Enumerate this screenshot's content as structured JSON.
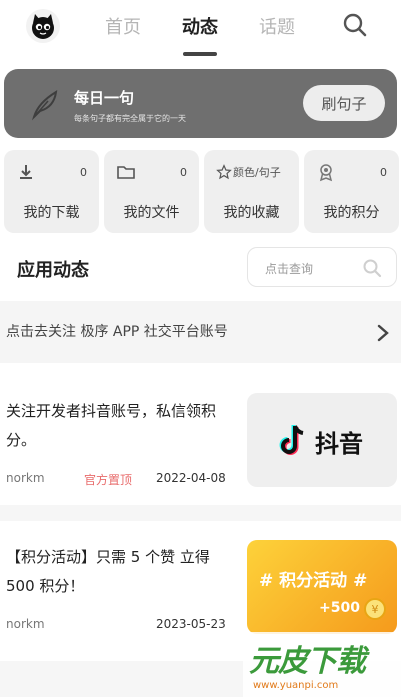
{
  "nav": {
    "tabs": [
      {
        "label": "首页",
        "active": false
      },
      {
        "label": "动态",
        "active": true
      },
      {
        "label": "话题",
        "active": false
      }
    ],
    "search_icon": "search-icon",
    "avatar_icon": "cat-mascot-avatar"
  },
  "banner": {
    "title": "每日一句",
    "subtitle": "每条句子都有完全属于它的一天",
    "button": "刷句子",
    "icon": "feather-icon",
    "bg_color": "#6f6f6f"
  },
  "stats": [
    {
      "label": "我的下载",
      "count": "0",
      "icon": "download-icon"
    },
    {
      "label": "我的文件",
      "count": "0",
      "icon": "folder-icon"
    },
    {
      "label": "我的收藏",
      "count": "颜色/句子",
      "icon": "star-icon"
    },
    {
      "label": "我的积分",
      "count": "0",
      "icon": "medal-icon"
    }
  ],
  "section": {
    "title": "应用动态",
    "search_placeholder": "点击查询"
  },
  "follow": {
    "text": "点击去关注 极序 APP 社交平台账号",
    "icon": "chevron-right-icon"
  },
  "posts": [
    {
      "title": "关注开发者抖音账号，私信领积分。",
      "author": "norkm",
      "tag": "官方置顶",
      "date": "2022-04-08",
      "thumb_text": "抖音",
      "thumb_icon": "tiktok-logo"
    },
    {
      "title": "【积分活动】只需 5 个赞 立得 500 积分！",
      "author": "norkm",
      "tag": "",
      "date": "2023-05-23",
      "thumb_text": "# 积分活动 #",
      "thumb_sub": "+500",
      "thumb_icon": "coin-icon"
    }
  ],
  "watermark": {
    "big": "元皮下载",
    "small": "www.yuanpi.com"
  },
  "colors": {
    "accent_tag": "#e86b6b",
    "banner_bg": "#6f6f6f",
    "promo_orange": "#f7a51c"
  }
}
